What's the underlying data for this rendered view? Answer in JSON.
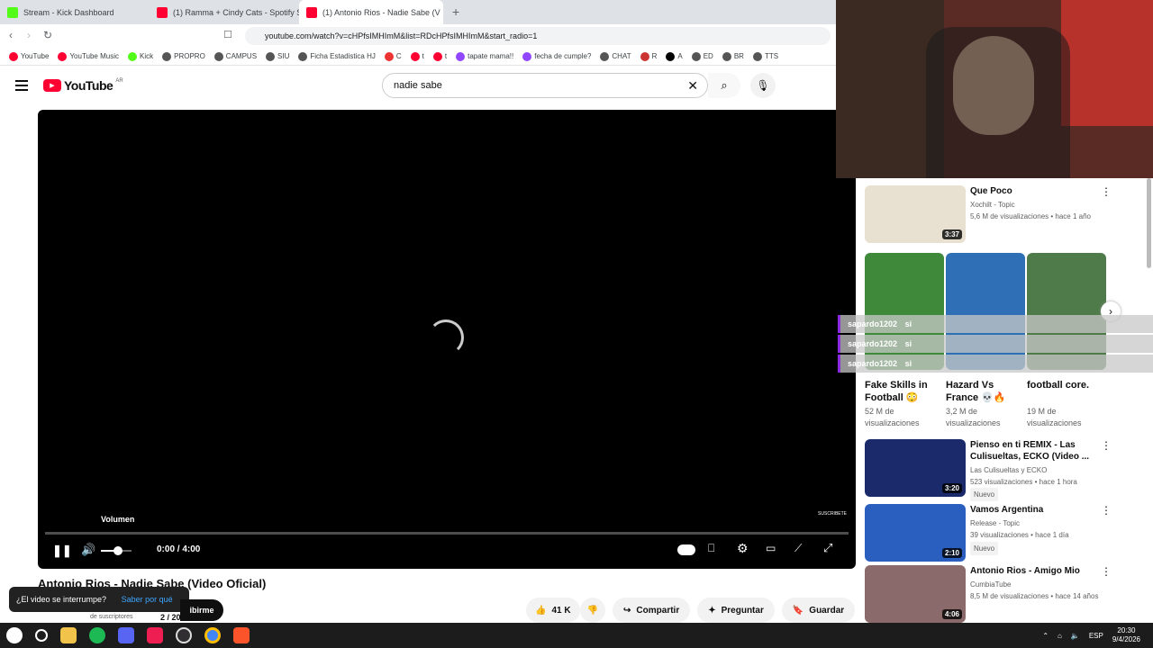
{
  "browser": {
    "tabs": [
      {
        "title": "Stream - Kick Dashboard",
        "color": "#53fc18"
      },
      {
        "title": "(1) Ramma + Cindy Cats - Spotify Se",
        "color": "#ff0033"
      },
      {
        "title": "(1) Antonio Rios - Nadie Sabe (V",
        "color": "#ff0033"
      }
    ],
    "url": "youtube.com/watch?v=cHPfsIMHImM&list=RDcHPfsIMHImM&start_radio=1",
    "bookmarks": [
      "YouTube",
      "YouTube Music",
      "Kick",
      "PROPRO",
      "CAMPUS",
      "SIU",
      "Ficha Estadistica HJ",
      "C",
      "t",
      "t",
      "tapate mama!!",
      "fecha de cumple?",
      "CHAT",
      "R",
      "A",
      "ED",
      "BR",
      "TTS"
    ]
  },
  "youtube": {
    "logo": "YouTube",
    "region": "AR",
    "search_value": "nadie sabe"
  },
  "player": {
    "volume_tooltip": "Volumen",
    "time": "0:00 / 4:00",
    "watermark": "SUSCRIBETE"
  },
  "video": {
    "title": "Antonio Rios - Nadie Sabe (Video Oficial)",
    "likes": "41 K",
    "share": "Compartir",
    "ask": "Preguntar",
    "save": "Guardar",
    "subscribe_partial": "ibirme",
    "playlist_count": "2 / 20",
    "toast_text": "¿El video se interrumpe?",
    "toast_link": "Saber por qué",
    "subscribers_partial": "de suscriptores"
  },
  "sidebar": {
    "cards": [
      {
        "title": "Que Poco",
        "channel": "Xochilt - Topic",
        "meta": "5,6 M de visualizaciones • hace 1 año",
        "duration": "3:37",
        "thumb": "#e8e0d0"
      },
      {
        "title": "Pienso en ti REMIX - Las Culisueltas, ECKO (Video ...",
        "channel": "Las Culisueltas  y ECKO",
        "meta": "523 visualizaciones • hace 1 hora",
        "badge": "Nuevo",
        "duration": "3:20",
        "thumb": "#1a2a6a"
      },
      {
        "title": "Vamos Argentina",
        "channel": "Release - Topic",
        "meta": "39 visualizaciones • hace 1 día",
        "badge": "Nuevo",
        "duration": "2:10",
        "thumb": "#2a5fc0"
      },
      {
        "title": "Antonio Rios - Amigo Mio",
        "channel": "CumbiaTube",
        "meta": "8,5 M de visualizaciones • hace 14 años",
        "duration": "4:06",
        "thumb": "#8a6a6a"
      }
    ],
    "shorts": [
      {
        "title": "Fake Skills in Football 😳",
        "meta": "52 M de visualizaciones",
        "thumb": "#3e8a3a"
      },
      {
        "title": "Hazard Vs France 💀🔥",
        "meta": "3,2 M de visualizaciones",
        "thumb": "#2f6fb5"
      },
      {
        "title": "football core.",
        "meta": "19 M de visualizaciones",
        "thumb": "#4f7a4a"
      }
    ]
  },
  "chat": [
    {
      "user": "sapardo1202",
      "msg": "si"
    },
    {
      "user": "sapardo1202",
      "msg": "si"
    },
    {
      "user": "sapardo1202",
      "msg": "si"
    }
  ],
  "taskbar": {
    "lang": "ESP",
    "time": "20:30",
    "date": "9/4/2026"
  }
}
